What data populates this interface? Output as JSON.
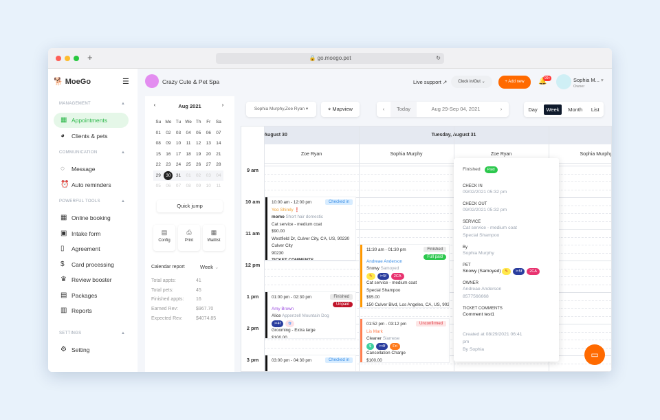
{
  "browser": {
    "url": "go.moego.pet",
    "new_tab": "+"
  },
  "brand": {
    "name": "MoeGo",
    "business": "Crazy Cute & Pet Spa"
  },
  "sidebar": {
    "sections": [
      {
        "title": "MANAGEMENT",
        "items": [
          {
            "label": "Appointments",
            "icon": "calendar-icon",
            "active": true
          },
          {
            "label": "Clients & pets",
            "icon": "dog-icon"
          }
        ]
      },
      {
        "title": "COMMUNICATION",
        "items": [
          {
            "label": "Message",
            "icon": "chat-icon"
          },
          {
            "label": "Auto reminders",
            "icon": "alarm-icon"
          }
        ]
      },
      {
        "title": "POWERFUL TOOLS",
        "items": [
          {
            "label": "Online booking",
            "icon": "calendar-icon"
          },
          {
            "label": "Intake form",
            "icon": "form-icon"
          },
          {
            "label": "Agreement",
            "icon": "document-icon"
          },
          {
            "label": "Card processing",
            "icon": "dollar-icon"
          },
          {
            "label": "Review booster",
            "icon": "crown-icon"
          },
          {
            "label": "Packages",
            "icon": "package-icon"
          },
          {
            "label": "Reports",
            "icon": "chart-icon"
          }
        ]
      },
      {
        "title": "SETTINGS",
        "items": [
          {
            "label": "Setting",
            "icon": "gear-icon"
          }
        ]
      }
    ]
  },
  "header": {
    "live_support": "Live support",
    "clock": "Clock in/Out",
    "add_new": "+ Add new",
    "notif": "99+",
    "user_name": "Sophia M...",
    "user_role": "Owner",
    "accent": "#ff6a00"
  },
  "minical": {
    "title": "Aug 2021",
    "weekdays": [
      "Su",
      "Mo",
      "Tu",
      "We",
      "Th",
      "Fr",
      "Sa"
    ],
    "weeks": [
      [
        "01",
        "02",
        "03",
        "04",
        "05",
        "06",
        "07"
      ],
      [
        "08",
        "09",
        "10",
        "11",
        "12",
        "13",
        "14"
      ],
      [
        "15",
        "16",
        "17",
        "18",
        "19",
        "20",
        "21"
      ],
      [
        "22",
        "23",
        "24",
        "25",
        "26",
        "27",
        "28"
      ],
      [
        "29",
        "30",
        "31",
        "01",
        "02",
        "03",
        "04"
      ],
      [
        "05",
        "06",
        "07",
        "08",
        "09",
        "10",
        "11"
      ]
    ],
    "selected": "30",
    "quick_jump": "Quick jump"
  },
  "tools": [
    {
      "label": "Config"
    },
    {
      "label": "Print"
    },
    {
      "label": "Waitlist"
    }
  ],
  "report": {
    "title": "Calendar report",
    "period": "Week",
    "rows": [
      {
        "k": "Total appts:",
        "v": "41"
      },
      {
        "k": "Total pets:",
        "v": "45"
      },
      {
        "k": "Finished appts:",
        "v": "16"
      },
      {
        "k": "Earned Rev:",
        "v": "$967.70"
      },
      {
        "k": "Expected Rev:",
        "v": "$4074.85"
      }
    ]
  },
  "toolbar": {
    "staff": "Sophia Murphy,Zoe Ryan",
    "mapview": "Mapview",
    "today": "Today",
    "range": "Aug 29-Sep 04, 2021",
    "views": [
      "Day",
      "Week",
      "Month",
      "List"
    ],
    "active_view": "Week"
  },
  "calendar": {
    "days": [
      "August 30",
      "Tuesday, August 31"
    ],
    "staff": [
      "Zoe Ryan",
      "Sophia Murphy",
      "Zoe Ryan",
      "Sophia Murphy"
    ],
    "hours": [
      "9 am",
      "10 am",
      "11 am",
      "12 pm",
      "1 pm",
      "2 pm",
      "3 pm"
    ],
    "appointments": [
      {
        "time": "10:00 am - 12:00 pm",
        "status": "Checked in",
        "client": "Yoo Shirely",
        "pet": "momo",
        "breed": "Short hair domestic",
        "service": "Cat service - medium coat",
        "price": "$90.00",
        "address": "Westfield Dr, Culver City, CA, US, 90230",
        "city": "Culver City",
        "zip": "90230",
        "comments": "TICKET COMMENTS"
      },
      {
        "time": "01:00 pm - 02:30 pm",
        "status": "Finished",
        "payment": "Unpaid",
        "client": "Amy Brown",
        "pet": "Alice",
        "breed": "Appenzell Mountain Dog",
        "tag": "4f",
        "service": "Grooming - Extra large",
        "price": "$100.00"
      },
      {
        "time": "03:00 pm - 04:30 pm",
        "status": "Checked in"
      },
      {
        "time": "11:30 am - 01:30 pm",
        "status": "Finished",
        "payment": "Full paid",
        "client": "Andreae Anderson",
        "pet": "Snowy",
        "breed": "Samoyed",
        "tag1": "5f",
        "tag2": "2CA",
        "service": "Cat service - medium coat",
        "service2": "Special Shampoo",
        "price": "$95.00",
        "address": "150 Culver Blvd, Los Angeles, CA, US, 902"
      },
      {
        "time": "01:52 pm - 03:12 pm",
        "status": "Unconfirmed",
        "client": "Lis Mark",
        "pet": "Cleaner",
        "breed": "Siamese",
        "tag1": "4f",
        "tag2": "Fri",
        "service": "Cancellation Charge",
        "price": "$100.00"
      }
    ]
  },
  "popup": {
    "status": "Finished",
    "payment": "Paid",
    "check_in_label": "CHECK IN",
    "check_in": "09/02/2021 05:32 pm",
    "check_out_label": "CHECK OUT",
    "check_out": "09/02/2021 05:32 pm",
    "service_label": "SERVICE",
    "service1": "Cat service - medium coat",
    "service2": "Special Shampoo",
    "by_label": "By",
    "by": "Sophia Murphy",
    "pet_label": "PET",
    "pet": "Snowy (Samoyed)",
    "tag1": "5f",
    "tag2": "2CA",
    "owner_label": "OWNER",
    "owner": "Andreae Anderson",
    "phone": "8577566668",
    "comments_label": "TICKET COMMENTS",
    "comments": "Comment test1",
    "created": "Created at 08/29/2021 06:41 pm",
    "created_by": "By Sophia"
  }
}
